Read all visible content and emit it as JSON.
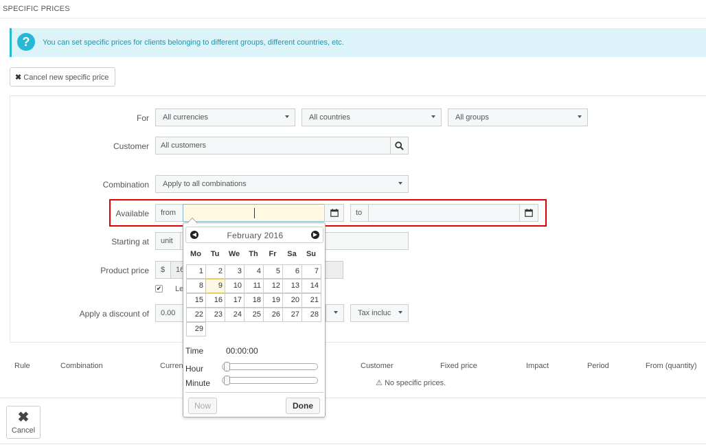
{
  "header": {
    "title": "SPECIFIC PRICES"
  },
  "alert": {
    "icon": "question-icon",
    "text": "You can set specific prices for clients belonging to different groups, different countries, etc."
  },
  "cancel_new_button": {
    "label": "Cancel new specific price",
    "icon": "close-icon"
  },
  "form": {
    "for_label": "For",
    "currency": "All currencies",
    "country": "All countries",
    "group": "All groups",
    "customer_label": "Customer",
    "customer_value": "All customers",
    "combination_label": "Combination",
    "combination_value": "Apply to all combinations",
    "available_label": "Available",
    "from_addon": "from",
    "to_addon": "to",
    "starting_label": "Starting at",
    "unit_addon": "unit",
    "price_label": "Product price",
    "currency_addon": "$",
    "price_value": "16",
    "leave_label": "Le",
    "discount_label": "Apply a discount of",
    "discount_value": "0.00",
    "tax_value": "Tax incluc"
  },
  "datepicker": {
    "month_label": "February 2016",
    "weekdays": [
      "Mo",
      "Tu",
      "We",
      "Th",
      "Fr",
      "Sa",
      "Su"
    ],
    "weeks": [
      [
        "",
        "",
        "",
        "",
        "",
        "",
        ""
      ],
      [
        "1",
        "2",
        "3",
        "4",
        "5",
        "6",
        "7"
      ],
      [
        "8",
        "9",
        "10",
        "11",
        "12",
        "13",
        "14"
      ],
      [
        "15",
        "16",
        "17",
        "18",
        "19",
        "20",
        "21"
      ],
      [
        "22",
        "23",
        "24",
        "25",
        "26",
        "27",
        "28"
      ],
      [
        "29",
        "",
        "",
        "",
        "",
        "",
        ""
      ]
    ],
    "selected_day": "9",
    "time_label": "Time",
    "time_value": "00:00:00",
    "hour_label": "Hour",
    "minute_label": "Minute",
    "now_label": "Now",
    "done_label": "Done",
    "hour_level": 0,
    "minute_level": 0
  },
  "table": {
    "columns": [
      "Rule",
      "Combination",
      "Curren",
      "Customer",
      "Fixed price",
      "Impact",
      "Period",
      "From (quantity)"
    ],
    "empty_text": "No specific prices."
  },
  "footer": {
    "cancel_label": "Cancel"
  }
}
